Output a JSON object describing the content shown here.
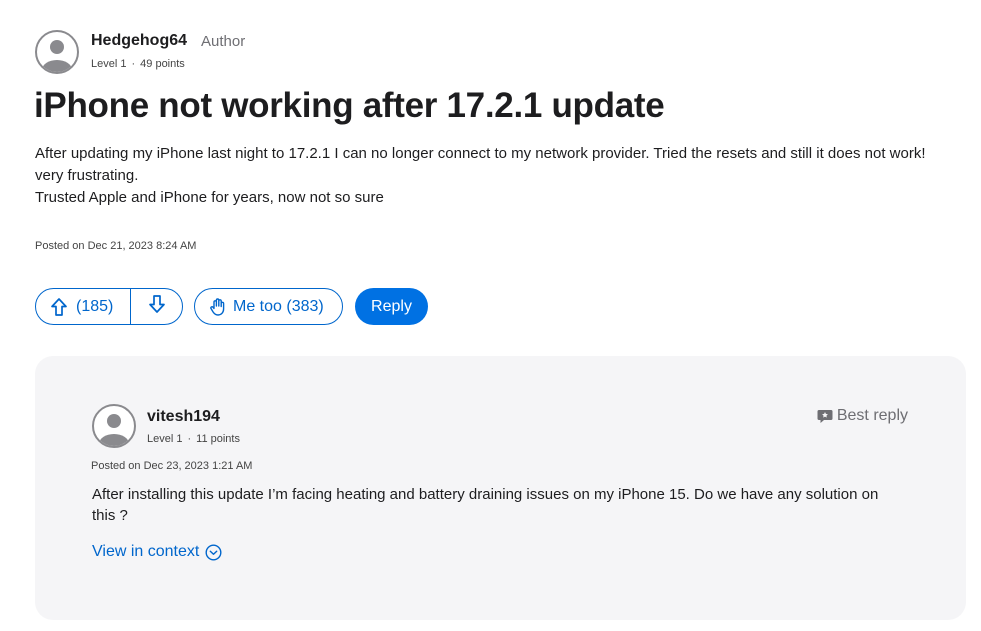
{
  "author": {
    "name": "Hedgehog64",
    "badge": "Author",
    "level": "Level 1",
    "separator": "·",
    "points": "49 points"
  },
  "post": {
    "title": "iPhone not working after 17.2.1 update",
    "body": [
      "After updating my iPhone last night to 17.2.1 I can no longer connect to my network provider. Tried the resets and still it does not work!",
      "very frustrating.",
      "Trusted Apple and iPhone for years, now not so sure"
    ],
    "posted": "Posted on Dec 21, 2023 8:24 AM"
  },
  "actions": {
    "upvote_label": "(185)",
    "metoo_label": "Me too (383)",
    "reply_label": "Reply"
  },
  "best_reply": {
    "badge": "Best reply",
    "user": {
      "name": "vitesh194",
      "level": "Level 1",
      "separator": "·",
      "points": "11 points"
    },
    "posted": "Posted on Dec 23, 2023 1:21 AM",
    "body": "After installing this update I’m facing heating and battery draining issues on my iPhone 15. Do we have any solution on this ?",
    "context_link": "View in context"
  },
  "colors": {
    "accent": "#0066cc",
    "reply_button": "#0071e3",
    "card_bg": "#f5f5f7"
  },
  "icons": [
    "user-avatar-icon",
    "arrow-up-icon",
    "arrow-down-icon",
    "raised-hand-icon",
    "speech-bubble-icon",
    "chevron-down-circle-icon"
  ]
}
